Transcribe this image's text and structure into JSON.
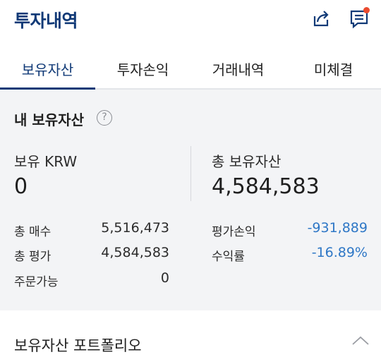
{
  "header": {
    "title": "투자내역",
    "share_icon": "share-icon",
    "notice_icon": "notice-icon",
    "notice_dot_color": "#ea4b2f"
  },
  "tabs": [
    {
      "label": "보유자산",
      "active": true
    },
    {
      "label": "투자손익",
      "active": false
    },
    {
      "label": "거래내역",
      "active": false
    },
    {
      "label": "미체결",
      "active": false
    }
  ],
  "summary": {
    "title": "내 보유자산",
    "help_icon": "help-icon",
    "holding_krw_label": "보유 KRW",
    "holding_krw_value": "0",
    "total_assets_label": "총 보유자산",
    "total_assets_value": "4,584,583",
    "rows_left": [
      {
        "label": "총 매수",
        "value": "5,516,473"
      },
      {
        "label": "총 평가",
        "value": "4,584,583"
      },
      {
        "label": "주문가능",
        "value": "0"
      }
    ],
    "rows_right": [
      {
        "label": "평가손익",
        "value": "-931,889"
      },
      {
        "label": "수익률",
        "value": "-16.89%"
      }
    ]
  },
  "portfolio": {
    "title": "보유자산 포트폴리오",
    "toggle_icon": "chevron-up-icon"
  },
  "colors": {
    "brand": "#113a77",
    "negative": "#2e77c6",
    "summary_bg": "#f3f4f6"
  }
}
